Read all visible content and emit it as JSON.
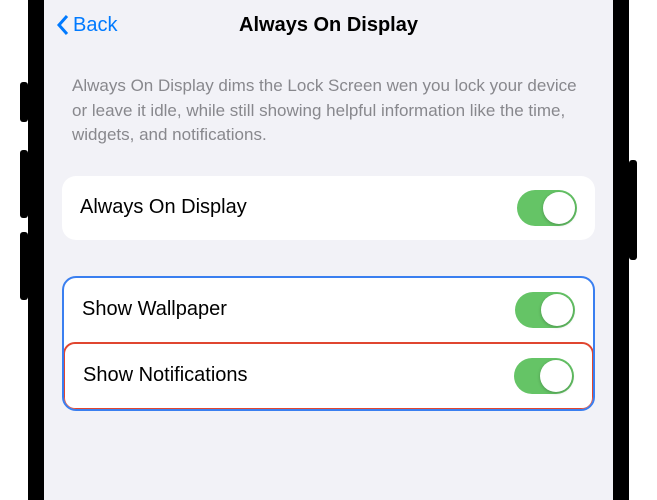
{
  "nav": {
    "back_label": "Back",
    "title": "Always On Display"
  },
  "description": "Always On Display dims the Lock Screen wen you lock your device or leave it idle, while still showing helpful information like the time, widgets, and notifications.",
  "settings": {
    "always_on_display": {
      "label": "Always On Display",
      "enabled": true
    },
    "show_wallpaper": {
      "label": "Show Wallpaper",
      "enabled": true
    },
    "show_notifications": {
      "label": "Show Notifications",
      "enabled": true
    }
  },
  "colors": {
    "accent": "#007aff",
    "toggle_on": "#65c466",
    "highlight_outer": "#3a7ff0",
    "highlight_inner": "#e04630"
  }
}
